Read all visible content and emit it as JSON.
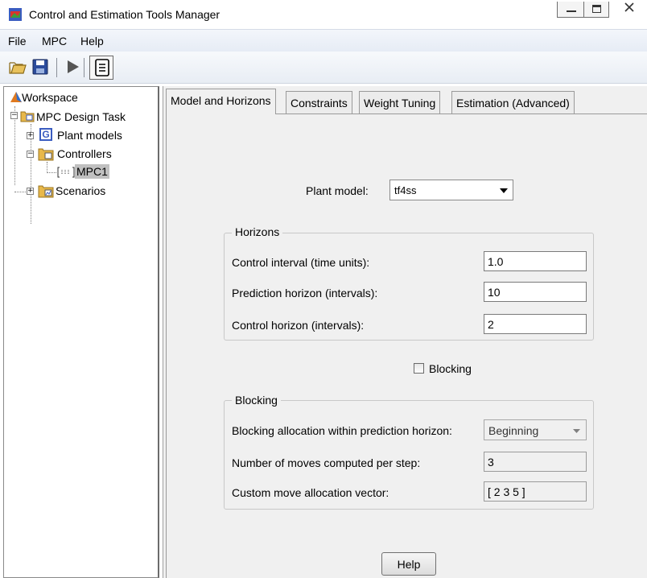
{
  "window": {
    "title": "Control and Estimation Tools Manager",
    "controls": [
      "minimize-icon",
      "maximize-icon",
      "close-icon"
    ]
  },
  "menu": {
    "items": [
      "File",
      "MPC",
      "Help"
    ]
  },
  "toolbar": {
    "buttons": [
      "open-folder-icon",
      "save-icon",
      "play-icon",
      "document-icon"
    ]
  },
  "tree": {
    "root": "Workspace",
    "task": "MPC Design Task",
    "plant_models": "Plant models",
    "controllers": "Controllers",
    "controller_item": "MPC1",
    "scenarios": "Scenarios"
  },
  "tabs": [
    "Model and Horizons",
    "Constraints",
    "Weight Tuning",
    "Estimation (Advanced)"
  ],
  "plant_model": {
    "label": "Plant model:",
    "value": "tf4ss"
  },
  "horizons": {
    "title": "Horizons",
    "control_interval_label": "Control interval (time units):",
    "control_interval_value": "1.0",
    "prediction_horizon_label": "Prediction horizon (intervals):",
    "prediction_horizon_value": "10",
    "control_horizon_label": "Control horizon (intervals):",
    "control_horizon_value": "2"
  },
  "blocking_checkbox": {
    "label": "Blocking",
    "checked": false
  },
  "blocking": {
    "title": "Blocking",
    "allocation_label": "Blocking allocation within prediction horizon:",
    "allocation_value": "Beginning",
    "moves_label": "Number of moves computed per step:",
    "moves_value": "3",
    "vector_label": "Custom move allocation vector:",
    "vector_value": "[ 2 3 5 ]"
  },
  "help_button": "Help",
  "colors": {
    "selection": "#c0c0c0",
    "panel": "#f0f0f0",
    "folder": "#e8b84a",
    "tree_text": "#000000"
  }
}
